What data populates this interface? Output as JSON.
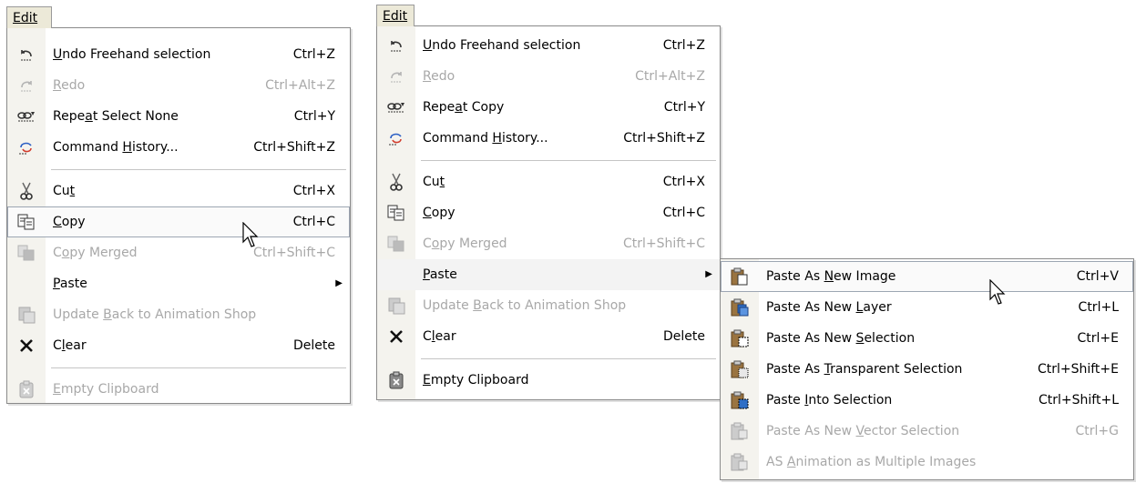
{
  "menu_left": {
    "title": "Edit",
    "items": [
      {
        "icon": "undo-icon",
        "pre": "",
        "key": "U",
        "post": "ndo Freehand selection",
        "shortcut": "Ctrl+Z",
        "disabled": false
      },
      {
        "icon": "redo-icon",
        "pre": "",
        "key": "R",
        "post": "edo",
        "shortcut": "Ctrl+Alt+Z",
        "disabled": true
      },
      {
        "icon": "repeat-icon",
        "pre": "Repe",
        "key": "a",
        "post": "t Select None",
        "shortcut": "Ctrl+Y",
        "disabled": false
      },
      {
        "icon": "history-icon",
        "pre": "Command ",
        "key": "H",
        "post": "istory...",
        "shortcut": "Ctrl+Shift+Z",
        "disabled": false
      },
      {
        "icon": "cut-icon",
        "pre": "Cu",
        "key": "t",
        "post": "",
        "shortcut": "Ctrl+X",
        "disabled": false
      },
      {
        "icon": "copy-icon",
        "pre": "",
        "key": "C",
        "post": "opy",
        "shortcut": "Ctrl+C",
        "disabled": false
      },
      {
        "icon": "copy-merged-icon",
        "pre": "C",
        "key": "o",
        "post": "py Merged",
        "shortcut": "Ctrl+Shift+C",
        "disabled": true
      },
      {
        "icon": "",
        "pre": "",
        "key": "P",
        "post": "aste",
        "shortcut": "",
        "disabled": false
      },
      {
        "icon": "animation-shop-icon",
        "pre": "Update ",
        "key": "B",
        "post": "ack to Animation Shop",
        "shortcut": "",
        "disabled": true
      },
      {
        "icon": "clear-icon",
        "pre": "C",
        "key": "l",
        "post": "ear",
        "shortcut": "Delete",
        "disabled": false
      },
      {
        "icon": "empty-clipboard-icon",
        "pre": "",
        "key": "E",
        "post": "mpty Clipboard",
        "shortcut": "",
        "disabled": true
      }
    ]
  },
  "menu_right": {
    "title": "Edit",
    "items": [
      {
        "icon": "undo-icon",
        "pre": "",
        "key": "U",
        "post": "ndo Freehand selection",
        "shortcut": "Ctrl+Z",
        "disabled": false
      },
      {
        "icon": "redo-icon",
        "pre": "",
        "key": "R",
        "post": "edo",
        "shortcut": "Ctrl+Alt+Z",
        "disabled": true
      },
      {
        "icon": "repeat-icon",
        "pre": "Repe",
        "key": "a",
        "post": "t Copy",
        "shortcut": "Ctrl+Y",
        "disabled": false
      },
      {
        "icon": "history-icon",
        "pre": "Command ",
        "key": "H",
        "post": "istory...",
        "shortcut": "Ctrl+Shift+Z",
        "disabled": false
      },
      {
        "icon": "cut-icon",
        "pre": "Cu",
        "key": "t",
        "post": "",
        "shortcut": "Ctrl+X",
        "disabled": false
      },
      {
        "icon": "copy-icon",
        "pre": "",
        "key": "C",
        "post": "opy",
        "shortcut": "Ctrl+C",
        "disabled": false
      },
      {
        "icon": "copy-merged-icon",
        "pre": "C",
        "key": "o",
        "post": "py Merged",
        "shortcut": "Ctrl+Shift+C",
        "disabled": true
      },
      {
        "icon": "",
        "pre": "",
        "key": "P",
        "post": "aste",
        "shortcut": "",
        "disabled": false
      },
      {
        "icon": "animation-shop-icon",
        "pre": "Update ",
        "key": "B",
        "post": "ack to Animation Shop",
        "shortcut": "",
        "disabled": true
      },
      {
        "icon": "clear-icon",
        "pre": "C",
        "key": "l",
        "post": "ear",
        "shortcut": "Delete",
        "disabled": false
      },
      {
        "icon": "empty-clipboard-icon",
        "pre": "",
        "key": "E",
        "post": "mpty Clipboard",
        "shortcut": "",
        "disabled": false
      }
    ]
  },
  "paste_submenu": {
    "items": [
      {
        "icon": "paste-new-image-icon",
        "pre": "Paste As ",
        "key": "N",
        "post": "ew Image",
        "shortcut": "Ctrl+V",
        "disabled": false
      },
      {
        "icon": "paste-new-layer-icon",
        "pre": "Paste As New ",
        "key": "L",
        "post": "ayer",
        "shortcut": "Ctrl+L",
        "disabled": false
      },
      {
        "icon": "paste-new-selection-icon",
        "pre": "Paste As New ",
        "key": "S",
        "post": "election",
        "shortcut": "Ctrl+E",
        "disabled": false
      },
      {
        "icon": "paste-transparent-selection-icon",
        "pre": "Paste As ",
        "key": "T",
        "post": "ransparent Selection",
        "shortcut": "Ctrl+Shift+E",
        "disabled": false
      },
      {
        "icon": "paste-into-selection-icon",
        "pre": "Paste ",
        "key": "I",
        "post": "nto Selection",
        "shortcut": "Ctrl+Shift+L",
        "disabled": false
      },
      {
        "icon": "paste-vector-selection-icon",
        "pre": "Paste As New ",
        "key": "V",
        "post": "ector Selection",
        "shortcut": "Ctrl+G",
        "disabled": true
      },
      {
        "icon": "paste-animation-icon",
        "pre": "AS ",
        "key": "A",
        "post": "nimation as Multiple Images",
        "shortcut": "",
        "disabled": true
      }
    ]
  },
  "colors": {
    "disabled": "#a8a8a8",
    "accent_blue": "#2f6fc6",
    "clipboard_brown": "#9a7440"
  }
}
